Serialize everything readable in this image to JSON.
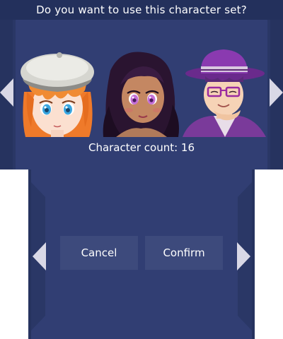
{
  "dialog": {
    "question": "Do you want to use this character set?",
    "count_label": "Character count: 16"
  },
  "characters": [
    {
      "description": "orange-haired girl with grey beret"
    },
    {
      "description": "dark-haired girl with purple eyes"
    },
    {
      "description": "boy with purple fedora and glasses"
    }
  ],
  "buttons": {
    "cancel": "Cancel",
    "confirm": "Confirm"
  },
  "icons": {
    "prev": "triangle-left-icon",
    "next": "triangle-right-icon"
  },
  "colors": {
    "screen_bg": "#313e73",
    "title_bg": "#23305c",
    "button_bg": "#3d4a7c",
    "arrow": "#d9d8e6",
    "text": "#ffffff"
  }
}
